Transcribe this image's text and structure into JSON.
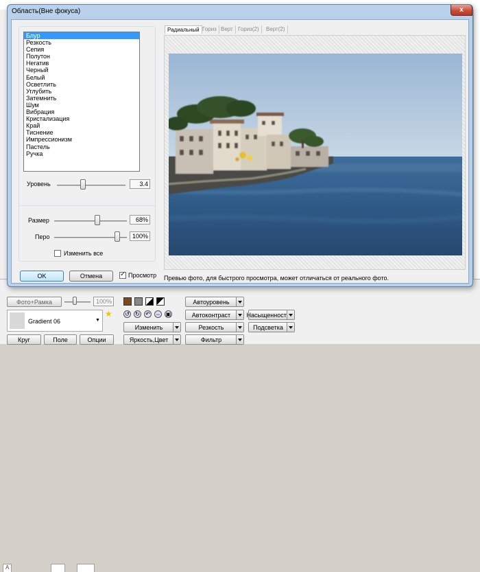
{
  "dialog": {
    "title": "Область(Вне фокуса)",
    "close_label": "x"
  },
  "effects": {
    "items": [
      "Блур",
      "Резкость",
      "Сепия",
      "Полутон",
      "Негатив",
      "Черный",
      "Белый",
      "Осветлить",
      "Углубить",
      "Затемнить",
      "Шум",
      "Вибрация",
      "Кристализация",
      "Край",
      "Тиснение",
      "Импрессионизм",
      "Пастель",
      "Ручка"
    ],
    "selected_index": 0
  },
  "level": {
    "label": "Уровень",
    "value": "3.4"
  },
  "size": {
    "label": "Размер",
    "value": "68%"
  },
  "feather": {
    "label": "Перо",
    "value": "100%"
  },
  "change_all": {
    "label": "Изменить все",
    "checked": false
  },
  "buttons": {
    "ok": "OK",
    "cancel": "Отмена"
  },
  "preview_toggle": {
    "label": "Просмотр",
    "checked": true
  },
  "preview": {
    "tabs": [
      "Радиальный",
      "Гориз",
      "Верт",
      "Гориз(2)",
      "Верт(2)"
    ],
    "active_tab": 0,
    "caption": "Превью фото, для быстрого просмотра, может отличаться от реального фото."
  },
  "background_app": {
    "photo_frame_label": "Фото+Рамка",
    "percent_value": "100%",
    "gradient_label": "Gradient 06",
    "shape_buttons": [
      "Круг",
      "Поле",
      "Опции"
    ],
    "adjust_buttons": [
      "Автоуровень",
      "Автоконтраст",
      "Насыщенность",
      "Изменить",
      "Резкость",
      "Подсветка",
      "Яркость,Цвет",
      "Фильтр"
    ],
    "colors": {
      "swatch_brown": "#7a4a22",
      "swatch_gray": "#888888",
      "star": "#f2c200"
    }
  }
}
